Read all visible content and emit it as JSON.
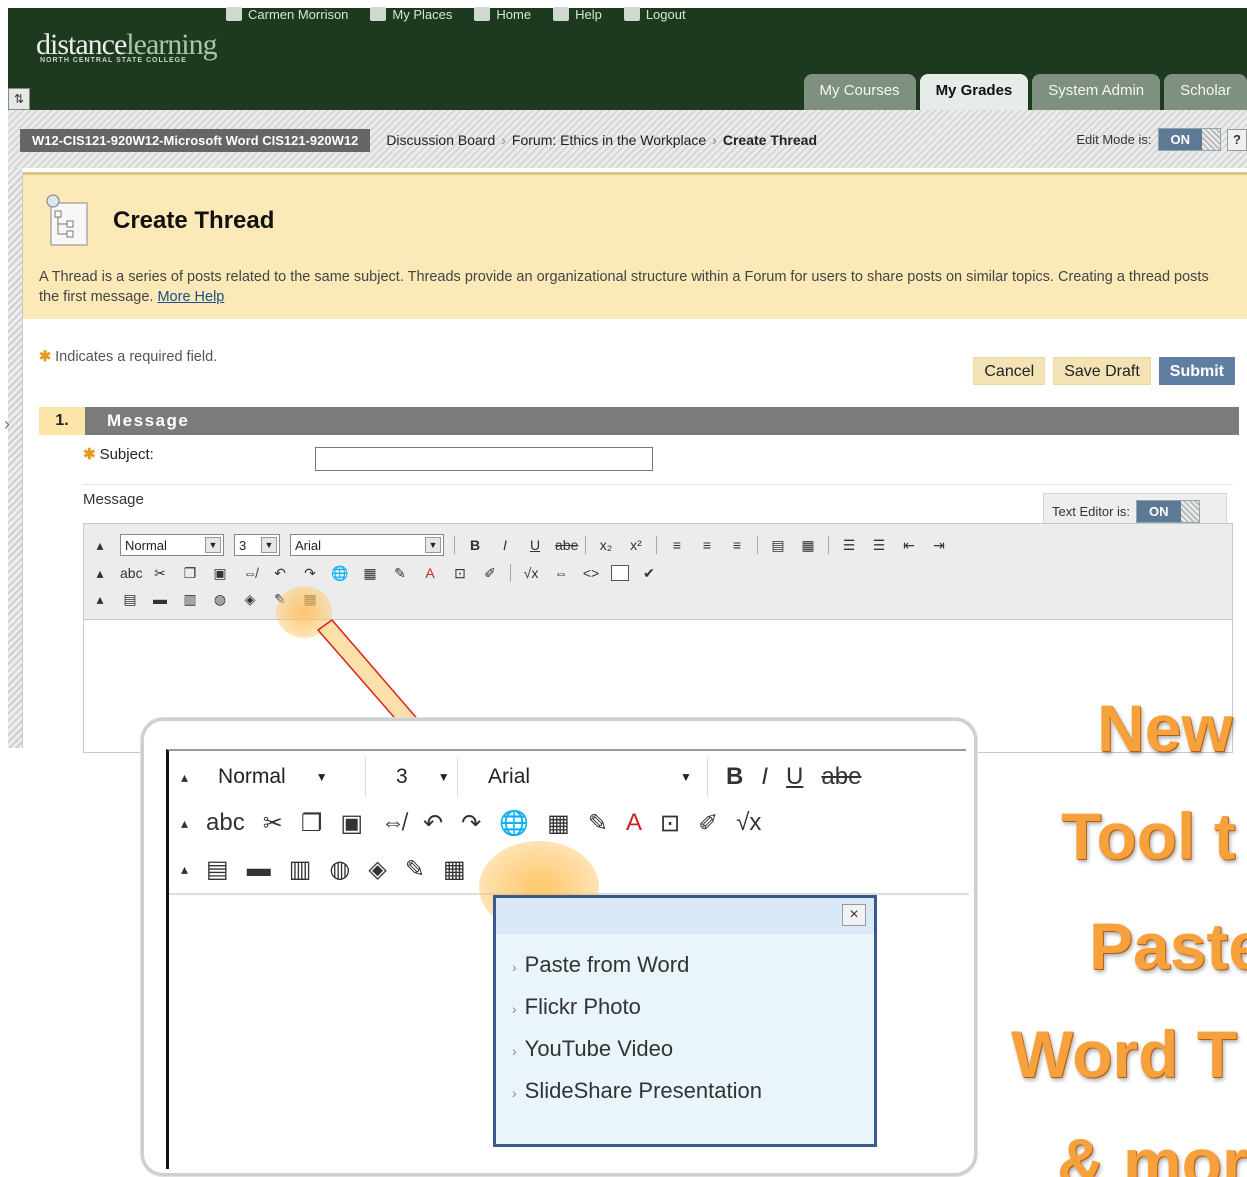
{
  "header": {
    "top_links": [
      "Carmen Morrison",
      "My Places",
      "Home",
      "Help",
      "Logout"
    ],
    "logo_main": "distance",
    "logo_accent": "learning",
    "logo_subtitle": "NORTH CENTRAL STATE COLLEGE",
    "tabs": [
      "My Courses",
      "My Grades",
      "System Admin",
      "Scholar"
    ]
  },
  "breadcrumb": {
    "course": "W12-CIS121-920W12-Microsoft Word CIS121-920W12",
    "items": [
      "Discussion Board",
      "Forum: Ethics in the Workplace",
      "Create Thread"
    ],
    "edit_mode_label": "Edit Mode is:",
    "edit_mode_value": "ON",
    "help": "?"
  },
  "page": {
    "title": "Create Thread",
    "description": "A Thread is a series of posts related to the same subject. Threads provide an organizational structure within a Forum for users to share posts on similar topics. Creating a thread posts the first message.",
    "more_help": "More Help",
    "required_note": "Indicates a required field.",
    "buttons": {
      "cancel": "Cancel",
      "save_draft": "Save Draft",
      "submit": "Submit"
    }
  },
  "section": {
    "number": "1.",
    "name": "Message",
    "subject_label": "Subject:",
    "message_label": "Message",
    "text_editor_label": "Text Editor is:",
    "text_editor_value": "ON"
  },
  "editor": {
    "format": "Normal",
    "size": "3",
    "font": "Arial",
    "bold": "B",
    "italic": "I",
    "underline": "U",
    "strike": "abe",
    "spell": "abc"
  },
  "callout": {
    "format": "Normal",
    "size": "3",
    "font": "Arial",
    "popup_items": [
      "Paste from Word",
      "Flickr Photo",
      "YouTube Video",
      "SlideShare Presentation"
    ],
    "close": "×"
  },
  "promo": [
    "New",
    "Tool t",
    "Paste",
    "Word T",
    "& mor"
  ],
  "colors": {
    "header_bg": "#1d3a1f",
    "hero_bg": "#fbe9b8",
    "submit_bg": "#5f7fa2",
    "promo_orange": "#f7a13c",
    "popup_border": "#3a5a8e"
  }
}
